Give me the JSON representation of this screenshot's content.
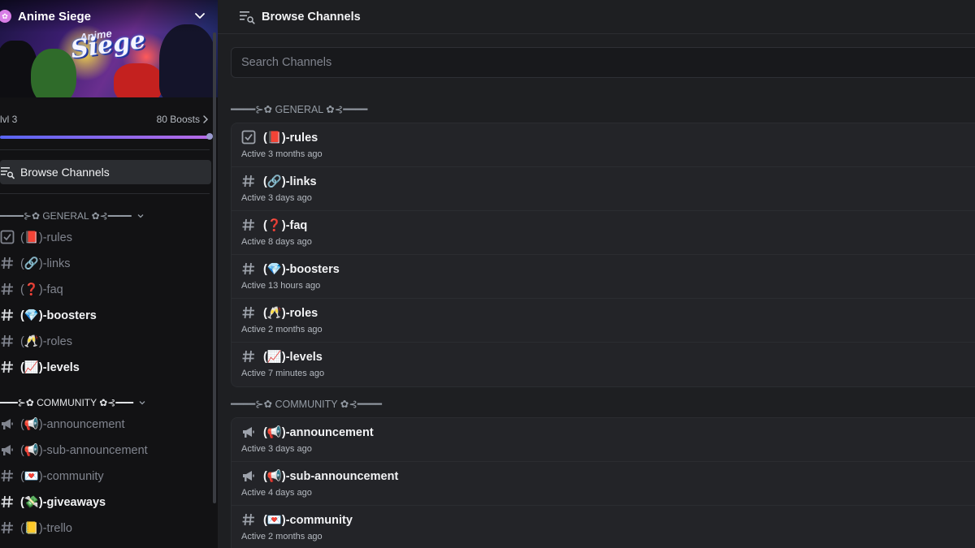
{
  "server": {
    "name": "Anime Siege",
    "banner_logo_small": "Anime",
    "banner_logo": "Siege",
    "level": "lvl 3",
    "boosts": "80 Boosts"
  },
  "sidebar": {
    "browse_label": "Browse Channels",
    "categories": [
      {
        "label": "━━━━⊱✿ GENERAL ✿⊰━━━━",
        "channels": [
          {
            "icon": "rules-icon",
            "label": "(📕)-rules",
            "unread": false
          },
          {
            "icon": "hash-icon",
            "label": "(🔗)-links",
            "unread": false
          },
          {
            "icon": "hash-icon",
            "label": "(❓)-faq",
            "unread": false
          },
          {
            "icon": "hash-icon",
            "label": "(💎)-boosters",
            "unread": true
          },
          {
            "icon": "hash-icon",
            "label": "(🥂)-roles",
            "unread": false
          },
          {
            "icon": "hash-icon",
            "label": "(📈)-levels",
            "unread": true
          }
        ]
      },
      {
        "label": "━━━⊱✿ COMMUNITY ✿⊰━━━",
        "channels": [
          {
            "icon": "announcement-icon",
            "label": "(📢)-announcement",
            "unread": false
          },
          {
            "icon": "announcement-icon",
            "label": "(📢)-sub-announcement",
            "unread": false
          },
          {
            "icon": "hash-icon",
            "label": "(💌)-community",
            "unread": false
          },
          {
            "icon": "hash-icon",
            "label": "(💸)-giveaways",
            "unread": true
          },
          {
            "icon": "hash-icon",
            "label": "(📒)-trello",
            "unread": false
          }
        ]
      }
    ]
  },
  "main": {
    "title": "Browse Channels",
    "search_placeholder": "Search Channels",
    "categories": [
      {
        "label": "━━━━⊱✿ GENERAL ✿⊰━━━━",
        "channels": [
          {
            "icon": "rules-icon",
            "label": "(📕)-rules",
            "activity": "Active 3 months ago"
          },
          {
            "icon": "hash-icon",
            "label": "(🔗)-links",
            "activity": "Active 3 days ago"
          },
          {
            "icon": "hash-icon",
            "label": "(❓)-faq",
            "activity": "Active 8 days ago"
          },
          {
            "icon": "hash-icon",
            "label": "(💎)-boosters",
            "activity": "Active 13 hours ago"
          },
          {
            "icon": "hash-icon",
            "label": "(🥂)-roles",
            "activity": "Active 2 months ago"
          },
          {
            "icon": "hash-icon",
            "label": "(📈)-levels",
            "activity": "Active 7 minutes ago"
          }
        ]
      },
      {
        "label": "━━━━⊱✿ COMMUNITY ✿⊰━━━━",
        "channels": [
          {
            "icon": "announcement-icon",
            "label": "(📢)-announcement",
            "activity": "Active 3 days ago"
          },
          {
            "icon": "announcement-icon",
            "label": "(📢)-sub-announcement",
            "activity": "Active 4 days ago"
          },
          {
            "icon": "hash-icon",
            "label": "(💌)-community",
            "activity": "Active 2 months ago"
          }
        ]
      }
    ]
  },
  "colors": {
    "background": "#1e1f22",
    "sidebar": "#121214",
    "boost_bar_start": "#5865f2",
    "boost_bar_end": "#b76ae6"
  }
}
